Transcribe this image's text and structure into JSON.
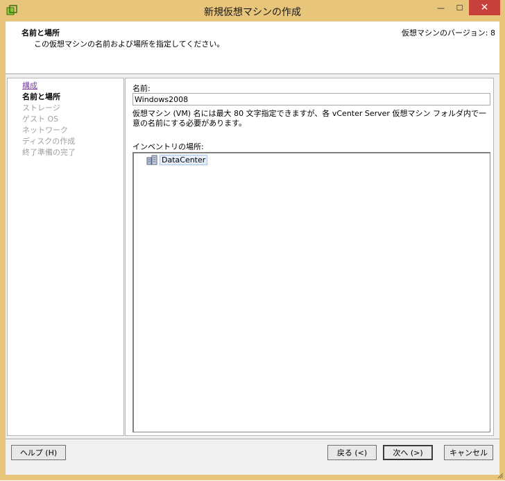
{
  "window": {
    "title": "新規仮想マシンの作成",
    "minimize_glyph": "—",
    "maximize_glyph": "☐",
    "close_glyph": "✕"
  },
  "header": {
    "title": "名前と場所",
    "subtitle": "この仮想マシンの名前および場所を指定してください。",
    "version": "仮想マシンのバージョン: 8"
  },
  "steps": [
    {
      "label": "構成",
      "state": "done"
    },
    {
      "label": "名前と場所",
      "state": "current"
    },
    {
      "label": "ストレージ",
      "state": "pending"
    },
    {
      "label": "ゲスト OS",
      "state": "pending"
    },
    {
      "label": "ネットワーク",
      "state": "pending"
    },
    {
      "label": "ディスクの作成",
      "state": "pending"
    },
    {
      "label": "終了準備の完了",
      "state": "pending"
    }
  ],
  "form": {
    "name_label": "名前:",
    "name_value": "Windows2008",
    "help_text": "仮想マシン (VM) 名には最大 80 文字指定できますが、各 vCenter Server 仮想マシン フォルダ内で一意の名前にする必要があります。",
    "inventory_label": "インベントリの場所:",
    "tree_items": [
      {
        "label": "DataCenter",
        "icon": "datacenter-icon",
        "selected": true
      }
    ]
  },
  "buttons": {
    "help": "ヘルプ (H)",
    "back": "戻る (<)",
    "next": "次へ (>)",
    "cancel": "キャンセル"
  },
  "colors": {
    "titlebar": "#e7c57a",
    "close_button": "#c7413b",
    "done_step": "#7b3fa0",
    "pending_step": "#a0a0a0"
  }
}
